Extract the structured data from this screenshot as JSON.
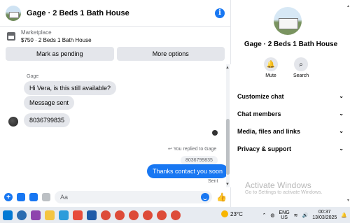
{
  "chat": {
    "title": "Gage · 2 Beds 1 Bath House",
    "marketplace_label": "Marketplace",
    "listing": "$750 · 2 Beds 1 Bath House",
    "actions": [
      "Mark as pending",
      "More options"
    ]
  },
  "messages": {
    "sender": "Gage",
    "incoming": [
      "Hi Vera, is this still available?",
      "Message sent",
      "8036799835"
    ],
    "reply_note": "You replied to Gage",
    "quoted": "8036799835",
    "outgoing": "Thanks contact you soon",
    "status": "Sent"
  },
  "composer": {
    "placeholder": "Aa"
  },
  "info": {
    "title": "Gage · 2 Beds 1 Bath House",
    "mute_label": "Mute",
    "search_label": "Search",
    "sections": [
      "Customize chat",
      "Chat members",
      "Media, files and links",
      "Privacy & support"
    ]
  },
  "watermark": {
    "line1": "Activate Windows",
    "line2": "Go to Settings to activate Windows."
  },
  "taskbar": {
    "temp": "23°C",
    "lang1": "ENG",
    "lang2": "US",
    "time": "00:37",
    "date": "13/03/2025"
  },
  "colors": {
    "accent": "#1877f2",
    "bubble_gray": "#e4e6eb"
  }
}
